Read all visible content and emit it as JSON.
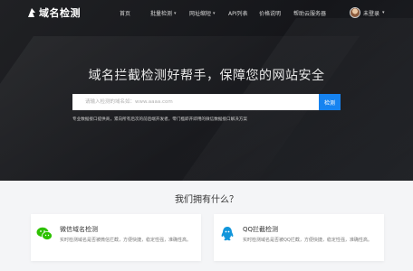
{
  "logo": {
    "text": "域名检测"
  },
  "nav": {
    "items": [
      {
        "label": "首页",
        "caret": false
      },
      {
        "label": "批量检测",
        "caret": true
      },
      {
        "label": "网址缩短",
        "caret": true
      },
      {
        "label": "API列表",
        "caret": false
      },
      {
        "label": "价格说明",
        "caret": false
      },
      {
        "label": "帮助云服务器",
        "caret": false
      }
    ],
    "user_name": "未登录"
  },
  "hero": {
    "headline": "域名拦截检测好帮手，保障您的网站安全",
    "search_placeholder": "请输入检测的域名如：www.aaaa.com",
    "search_button": "检测",
    "tagline": "专业数据接口提供商，累向所有后次的前后端开发者，零门槛即开即用的微信数据接口解决方案"
  },
  "features": {
    "title": "我们拥有什么？",
    "cards": [
      {
        "title": "微信域名检测",
        "desc": "实时检测域名是否被微信拦截，方便快捷，稳定性强，准确性高。",
        "icon": "wechat-icon",
        "color": "#2dc100"
      },
      {
        "title": "QQ拦截检测",
        "desc": "实时检测域名是否被QQ拦截，方便快捷，稳定性强，准确性高。",
        "icon": "qq-icon",
        "color": "#1296db"
      }
    ]
  },
  "colors": {
    "accent": "#1683f0"
  }
}
